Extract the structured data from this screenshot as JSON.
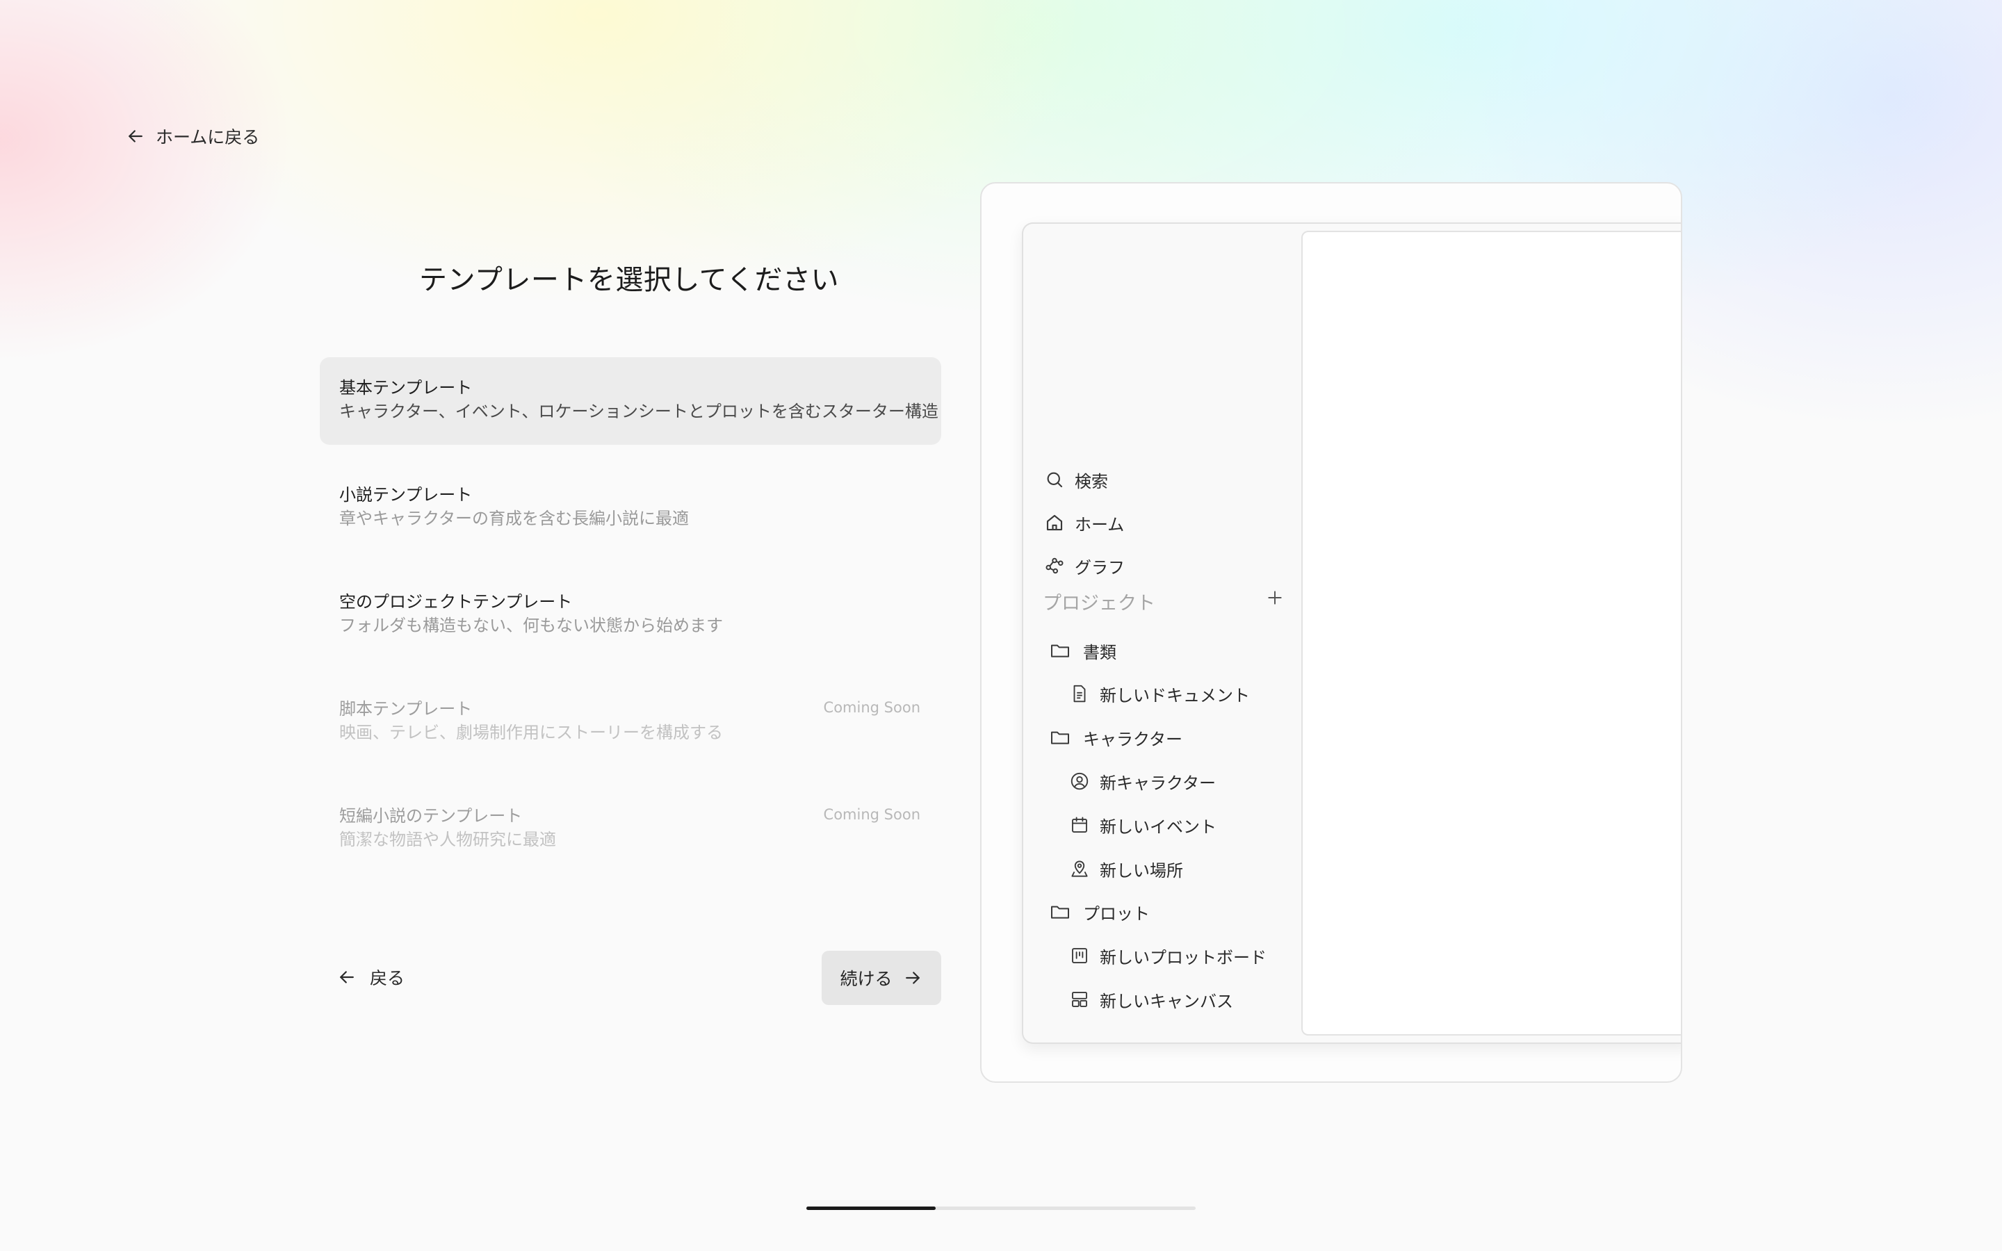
{
  "nav": {
    "back_home_label": "ホームに戻る"
  },
  "page_title": "テンプレートを選択してください",
  "templates": [
    {
      "name": "基本テンプレート",
      "description": "キャラクター、イベント、ロケーションシートとプロットを含むスターター構造",
      "selected": true
    },
    {
      "name": "小説テンプレート",
      "description": "章やキャラクターの育成を含む長編小説に最適"
    },
    {
      "name": "空のプロジェクトテンプレート",
      "description": "フォルダも構造もない、何もない状態から始めます"
    },
    {
      "name": "脚本テンプレート",
      "description": "映画、テレビ、劇場制作用にストーリーを構成する",
      "badge": "Coming Soon",
      "disabled": true
    },
    {
      "name": "短編小説のテンプレート",
      "description": "簡潔な物語や人物研究に最適",
      "badge": "Coming Soon",
      "disabled": true
    }
  ],
  "footer": {
    "back_label": "戻る",
    "continue_label": "続ける"
  },
  "preview": {
    "sidebar": {
      "search": "検索",
      "home": "ホーム",
      "graph": "グラフ",
      "section_label": "プロジェクト",
      "folders": [
        {
          "name": "書類",
          "items": [
            {
              "label": "新しいドキュメント",
              "icon": "document-icon"
            }
          ]
        },
        {
          "name": "キャラクター",
          "items": [
            {
              "label": "新キャラクター",
              "icon": "character-icon"
            },
            {
              "label": "新しいイベント",
              "icon": "calendar-icon"
            },
            {
              "label": "新しい場所",
              "icon": "location-icon"
            }
          ]
        },
        {
          "name": "プロット",
          "items": [
            {
              "label": "新しいプロットボード",
              "icon": "plotboard-icon"
            },
            {
              "label": "新しいキャンバス",
              "icon": "canvas-icon"
            }
          ]
        }
      ]
    }
  },
  "progress": {
    "step": 1,
    "total_steps": 3,
    "fraction": 0.333
  },
  "colors": {
    "selected_bg": "#ececec",
    "button_bg": "#e6e6e6",
    "progress_fill": "#1a1a1a",
    "muted_text": "#9d9d9d"
  }
}
